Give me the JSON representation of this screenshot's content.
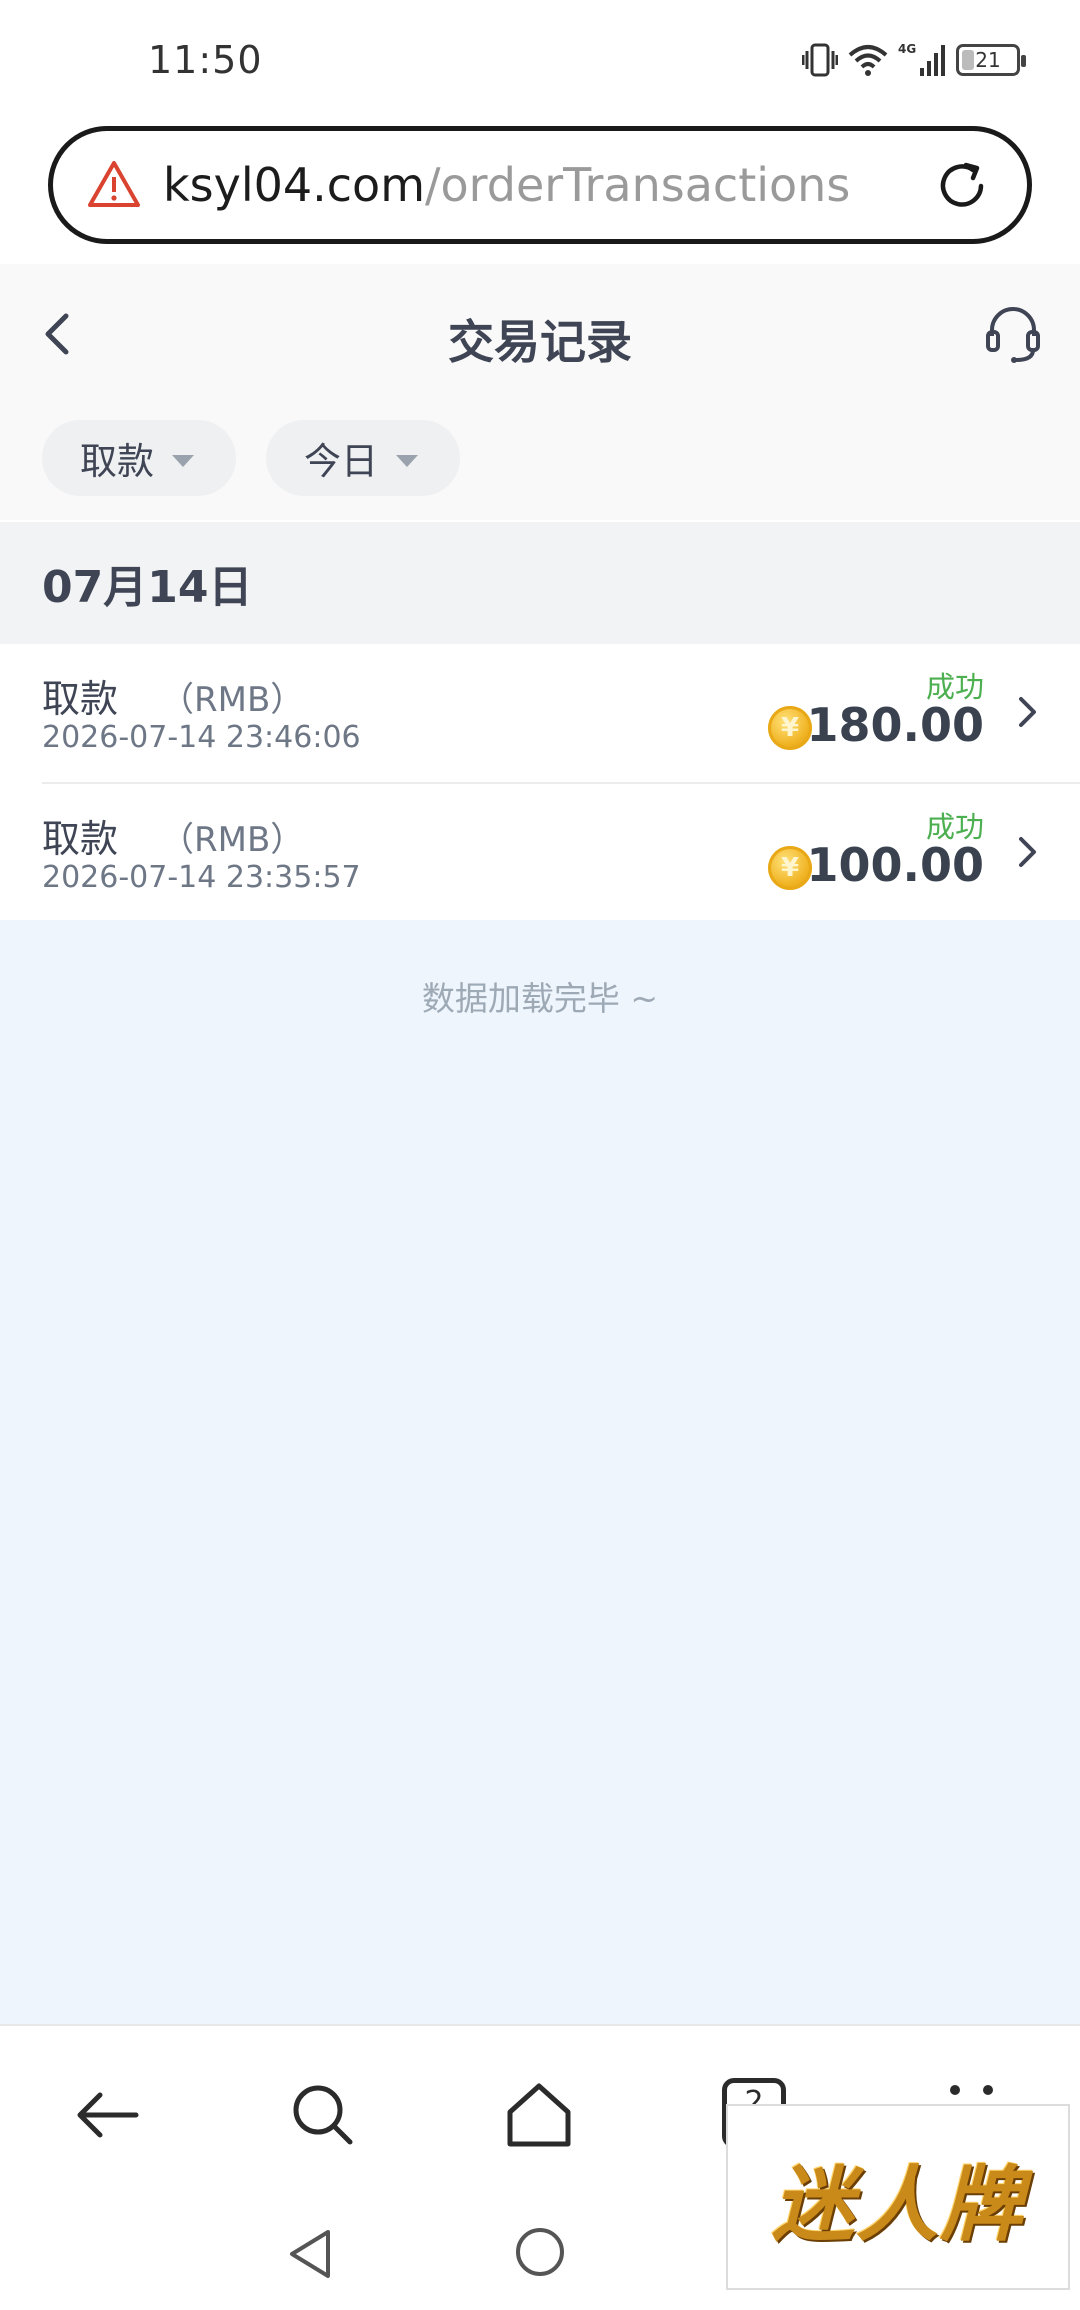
{
  "status_bar": {
    "time": "11:50",
    "network": "4G",
    "battery": "21",
    "icons": [
      "vibrate-icon",
      "wifi-icon",
      "signal-icon",
      "battery-icon"
    ]
  },
  "browser": {
    "url_domain": "ksyl04.com",
    "url_path": "/orderTransactions",
    "warning_color": "#d9432f"
  },
  "header": {
    "title": "交易记录"
  },
  "filters": {
    "type_label": "取款",
    "date_label": "今日"
  },
  "group": {
    "date_label": "07月14日"
  },
  "transactions": [
    {
      "type": "取款",
      "currency": "（RMB）",
      "time": "2026-07-14 23:46:06",
      "status": "成功",
      "amount": "180.00"
    },
    {
      "type": "取款",
      "currency": "（RMB）",
      "time": "2026-07-14 23:35:57",
      "status": "成功",
      "amount": "100.00"
    }
  ],
  "coin_symbol": "¥",
  "footer": {
    "load_complete": "数据加载完毕 ~"
  },
  "browser_nav": {
    "tab_count": "2"
  },
  "watermark": {
    "text": "迷人牌"
  },
  "colors": {
    "success": "#4caf50",
    "content_bg": "#eef5fc",
    "coin": "#f0b323"
  }
}
